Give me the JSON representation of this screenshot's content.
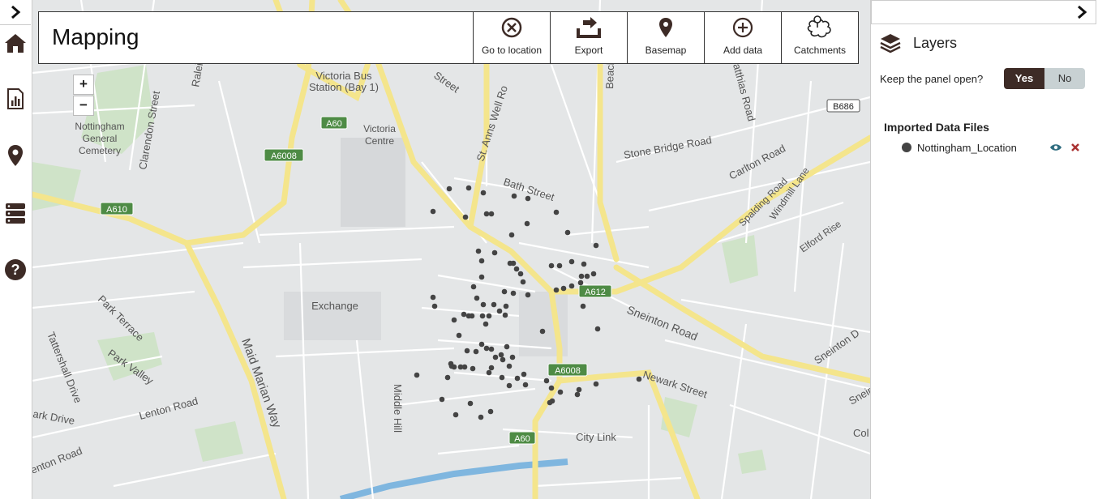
{
  "app": {
    "title": "Mapping"
  },
  "toolbar": {
    "buttons": [
      {
        "label": "Go to location",
        "icon": "crosshair-circle-icon"
      },
      {
        "label": "Export",
        "icon": "export-tray-icon"
      },
      {
        "label": "Basemap",
        "icon": "map-pin-icon"
      },
      {
        "label": "Add data",
        "icon": "plus-circle-icon"
      },
      {
        "label": "Catchments",
        "icon": "catchment-map-icon"
      }
    ]
  },
  "zoom": {
    "in": "+",
    "out": "−"
  },
  "leftnav": {
    "items": [
      {
        "icon": "home-icon"
      },
      {
        "icon": "report-chart-icon"
      },
      {
        "icon": "location-pin-icon"
      },
      {
        "icon": "database-icon"
      },
      {
        "icon": "help-icon"
      }
    ]
  },
  "panel": {
    "title": "Layers",
    "keep_open_label": "Keep the panel open?",
    "yes": "Yes",
    "no": "No",
    "imported_heading": "Imported Data Files",
    "layers": [
      {
        "name": "Nottingham_Location"
      }
    ]
  },
  "map": {
    "labels": {
      "victoria_bus": "Victoria Bus",
      "victoria_bus2": "Station (Bay 1)",
      "victoria_centre": "Victoria",
      "victoria_centre2": "Centre",
      "cemetery1": "Nottingham",
      "cemetery2": "General",
      "cemetery3": "Cemetery",
      "exchange": "Exchange",
      "city_link": "City   Link",
      "clarendon": "Clarendon  Street",
      "st_anns": "St. Anns  Well  Ro",
      "bath_street": "Bath   Street",
      "stone_bridge": "Stone  Bridge  Road",
      "carlton_road": "Carlton  Road",
      "spalding": "Spalding Road",
      "windmill": "Windmill Lane",
      "elford": "Elford  Rise",
      "sneinton_road": "Sneinton   Road",
      "newark": "Newark   Street",
      "sneinton_dale": "Sneinton  D",
      "maid_marian": "Maid  Marian  Way",
      "middle_hill": "Middle  Hill",
      "park_terrace": "Park  Terrace",
      "park_valley": "Park   Valley",
      "lenton_road": "Lenton    Road",
      "tattershall": "Tattershall  Drive",
      "park_drive": "ark  Drive",
      "lenton_road2": "enton  Road",
      "street_top": "Street",
      "beach": "Beach",
      "matthias": "atthias  Road",
      "raleigh": "Raleig",
      "sneinton_r": "Sneir",
      "col": "Col"
    },
    "road_shields": [
      "A60",
      "A6008",
      "A610",
      "A612",
      "A6008",
      "A60",
      "B686"
    ],
    "accent": "#3d2b26",
    "point_color": "#444444"
  }
}
